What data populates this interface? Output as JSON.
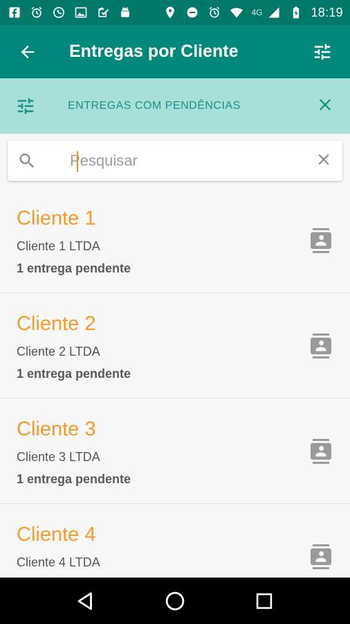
{
  "status_bar": {
    "network": "4G",
    "time": "18:19"
  },
  "app_bar": {
    "title": "Entregas por Cliente"
  },
  "filter": {
    "label": "ENTREGAS COM PENDÊNCIAS"
  },
  "search": {
    "placeholder": "Pesquisar",
    "value": ""
  },
  "clients": [
    {
      "name": "Cliente 1",
      "company": "Cliente 1 LTDA",
      "pending": "1 entrega pendente"
    },
    {
      "name": "Cliente 2",
      "company": "Cliente 2 LTDA",
      "pending": "1 entrega pendente"
    },
    {
      "name": "Cliente 3",
      "company": "Cliente 3 LTDA",
      "pending": "1 entrega pendente"
    },
    {
      "name": "Cliente 4",
      "company": "Cliente 4 LTDA",
      "pending": ""
    }
  ],
  "colors": {
    "status_bar": "#00796b",
    "app_bar": "#00897b",
    "filter_bar": "#a7dfd9",
    "filter_text": "#1b8f85",
    "client_name": "#f59b2c"
  },
  "icons": {
    "back": "arrow-back-icon",
    "filter": "tune-icon",
    "close": "close-icon",
    "search": "search-icon",
    "contact": "contact-card-icon"
  }
}
